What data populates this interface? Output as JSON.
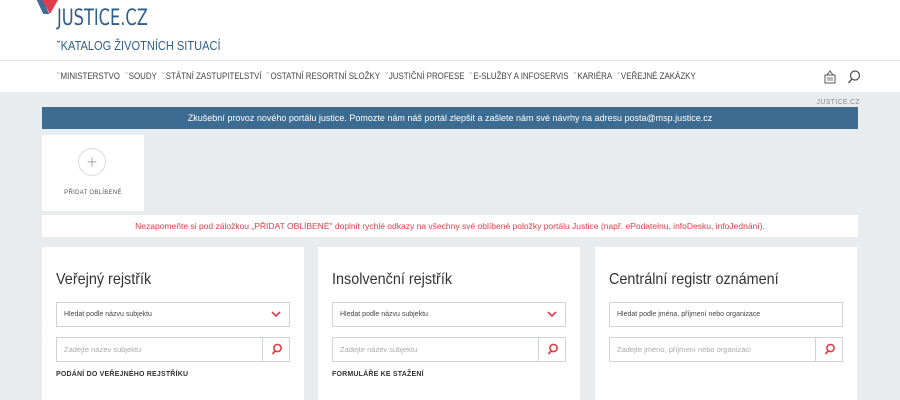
{
  "header": {
    "logo_title": "JUSTICE.CZ",
    "logo_subtitle": "˘KATALOG ŽIVOTNÍCH SITUACÍ",
    "accent": "#2f5e8a",
    "logo_red": "#e03c4a"
  },
  "nav": {
    "items": [
      {
        "label": "MINISTERSTVO"
      },
      {
        "label": "SOUDY"
      },
      {
        "label": "STÁTNÍ ZASTUPITELSTVÍ"
      },
      {
        "label": "OSTATNÍ RESORTNÍ SLOŽKY"
      },
      {
        "label": "JUSTIČNÍ PROFESE"
      },
      {
        "label": "E-SLUŽBY A INFOSERVIS"
      },
      {
        "label": "KARIÉRA"
      },
      {
        "label": "VEŘEJNÉ ZAKÁZKY"
      }
    ],
    "icons": [
      "mailbox-icon",
      "search-icon"
    ]
  },
  "breadcrumb": "JUSTICE.CZ",
  "notice": "Zkušební provoz nového portálu justice. Pomozte nám náš portál zlepšit a zašlete nám své návrhy na adresu posta@msp.justice.cz",
  "favorites": {
    "add_label": "PŘIDAT OBLÍBENÉ"
  },
  "warning": "Nezapomeňte si pod záložkou „PŘIDAT OBLÍBENÉ\" doplnit rychlé odkazy na všechny své oblíbené položky portálu Justice (např. ePodatelnu, infoDesku, infoJednání).",
  "cards": [
    {
      "title": "Veřejný rejstřík",
      "select_value": "Hledat podle názvu subjektu",
      "has_chevron": true,
      "input_placeholder": "Zadejte název subjektu",
      "link": "PODÁNÍ DO VEŘEJNÉHO REJSTŘÍKU"
    },
    {
      "title": "Insolvenční rejstřík",
      "select_value": "Hledat podle názvu subjektu",
      "has_chevron": true,
      "input_placeholder": "Zadejte název subjektu",
      "link": "FORMULÁŘE KE STAŽENÍ"
    },
    {
      "title": "Centrální registr oznámení",
      "select_value": "Hledat podle jména, příjmení nebo organizace",
      "has_chevron": false,
      "input_placeholder": "Zadejte jméno, příjmení nebo organizaci",
      "link": ""
    }
  ],
  "colors": {
    "notice_bg": "#3d6c93",
    "warning_text": "#e03c4a",
    "search_icon": "#e03c4a",
    "page_bg": "#e8ecef"
  }
}
